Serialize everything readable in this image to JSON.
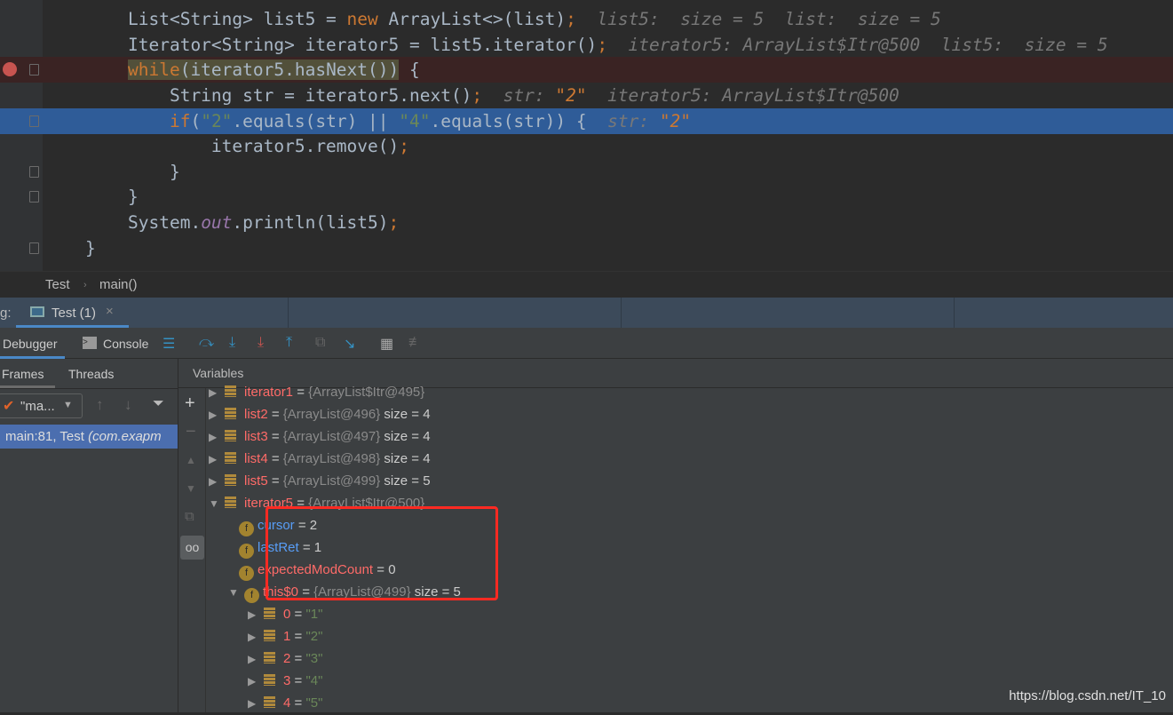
{
  "editor": {
    "lines": [
      {
        "code": [
          [
            "List<String> list5 = ",
            ""
          ],
          [
            "new",
            "kw"
          ],
          [
            " ArrayList<>(list)",
            ""
          ],
          [
            ";",
            "semi"
          ]
        ],
        "hint": [
          [
            "  list5:  size = 5  list:  size = 5",
            "hint"
          ]
        ]
      },
      {
        "code": [
          [
            "Iterator<String> iterator5 = list5.iterator()",
            ""
          ],
          [
            ";",
            "semi"
          ]
        ],
        "hint": [
          [
            "  iterator5: ArrayList$Itr@500  list5:  size = 5",
            "hint"
          ]
        ]
      },
      {
        "code": [
          [
            "while",
            "kw hl"
          ],
          [
            "(iterator5.hasNext())",
            "hl"
          ],
          [
            " {",
            ""
          ]
        ],
        "hint": []
      },
      {
        "code": [
          [
            "    String str = iterator5.next()",
            ""
          ],
          [
            ";",
            "semi"
          ]
        ],
        "hint": [
          [
            "  str: ",
            "hint"
          ],
          [
            "\"2\"",
            "hintv"
          ],
          [
            "  iterator5: ArrayList$Itr@500",
            "hint"
          ]
        ]
      },
      {
        "code": [
          [
            "    ",
            ""
          ],
          [
            "if",
            "kw"
          ],
          [
            "(",
            ""
          ],
          [
            "\"2\"",
            "str"
          ],
          [
            ".equals(str) || ",
            ""
          ],
          [
            "\"4\"",
            "str"
          ],
          [
            ".equals(str)) {",
            ""
          ]
        ],
        "hint": [
          [
            "  str: ",
            "hint"
          ],
          [
            "\"2\"",
            "hintv"
          ]
        ]
      },
      {
        "code": [
          [
            "        iterator5.remove()",
            ""
          ],
          [
            ";",
            "semi"
          ]
        ],
        "hint": []
      },
      {
        "code": [
          [
            "    }",
            ""
          ]
        ],
        "hint": []
      },
      {
        "code": [
          [
            "}",
            ""
          ]
        ],
        "hint": []
      },
      {
        "code": [
          [
            "System.",
            ""
          ],
          [
            "out",
            "st"
          ],
          [
            ".println(list5)",
            ""
          ],
          [
            ";",
            "semi"
          ]
        ],
        "hint": []
      },
      {
        "code": [
          [
            "}",
            ""
          ]
        ],
        "hint": [],
        "indent": -1
      }
    ]
  },
  "breadcrumb": {
    "items": [
      "Test",
      "main()"
    ]
  },
  "debug_tabs": {
    "prefix": "g:",
    "tab": "Test (1)"
  },
  "toolbar": {
    "debugger": "Debugger",
    "console": "Console"
  },
  "frames": {
    "tab_frames": "Frames",
    "tab_threads": "Threads",
    "thread": "\"ma...",
    "frame": "main:81, Test ",
    "frame_pkg": "(com.exapm"
  },
  "variables": {
    "header": "Variables",
    "rows": [
      {
        "lvl": 0,
        "exp": "▶",
        "icon": "list",
        "name": "iterator1",
        "nc": "vn",
        "val": "{ArrayList$Itr@495}",
        "extra": ""
      },
      {
        "lvl": 0,
        "exp": "▶",
        "icon": "list",
        "name": "list2",
        "nc": "vn",
        "val": "{ArrayList@496}",
        "extra": "size = 4"
      },
      {
        "lvl": 0,
        "exp": "▶",
        "icon": "list",
        "name": "list3",
        "nc": "vn",
        "val": "{ArrayList@497}",
        "extra": "size = 4"
      },
      {
        "lvl": 0,
        "exp": "▶",
        "icon": "list",
        "name": "list4",
        "nc": "vn",
        "val": "{ArrayList@498}",
        "extra": "size = 4"
      },
      {
        "lvl": 0,
        "exp": "▶",
        "icon": "list",
        "name": "list5",
        "nc": "vn",
        "val": "{ArrayList@499}",
        "extra": "size = 5"
      },
      {
        "lvl": 0,
        "exp": "▼",
        "icon": "list",
        "name": "iterator5",
        "nc": "vn",
        "val": "{ArrayList$Itr@500}",
        "extra": ""
      },
      {
        "lvl": 1,
        "exp": "",
        "icon": "field",
        "name": "cursor",
        "nc": "vb",
        "val": "",
        "extra": "2"
      },
      {
        "lvl": 1,
        "exp": "",
        "icon": "field",
        "name": "lastRet",
        "nc": "vb",
        "val": "",
        "extra": "1"
      },
      {
        "lvl": 1,
        "exp": "",
        "icon": "field",
        "name": "expectedModCount",
        "nc": "vn",
        "val": "",
        "extra": "0"
      },
      {
        "lvl": 1,
        "exp": "▼",
        "icon": "field",
        "name": "this$0",
        "nc": "vn",
        "val": "{ArrayList@499}",
        "extra": "size = 5"
      },
      {
        "lvl": 2,
        "exp": "▶",
        "icon": "list",
        "name": "0",
        "nc": "vn",
        "val": "",
        "extra": "\"1\"",
        "str": true
      },
      {
        "lvl": 2,
        "exp": "▶",
        "icon": "list",
        "name": "1",
        "nc": "vn",
        "val": "",
        "extra": "\"2\"",
        "str": true
      },
      {
        "lvl": 2,
        "exp": "▶",
        "icon": "list",
        "name": "2",
        "nc": "vn",
        "val": "",
        "extra": "\"3\"",
        "str": true
      },
      {
        "lvl": 2,
        "exp": "▶",
        "icon": "list",
        "name": "3",
        "nc": "vn",
        "val": "",
        "extra": "\"4\"",
        "str": true
      },
      {
        "lvl": 2,
        "exp": "▶",
        "icon": "list",
        "name": "4",
        "nc": "vn",
        "val": "",
        "extra": "\"5\"",
        "str": true
      }
    ]
  },
  "watermark": "https://blog.csdn.net/IT_10",
  "colors": {
    "accent": "#4a88c7",
    "highlight_box": "#ff2a22",
    "current_line": "#2f5c98",
    "breakpoint": "#c75450"
  }
}
